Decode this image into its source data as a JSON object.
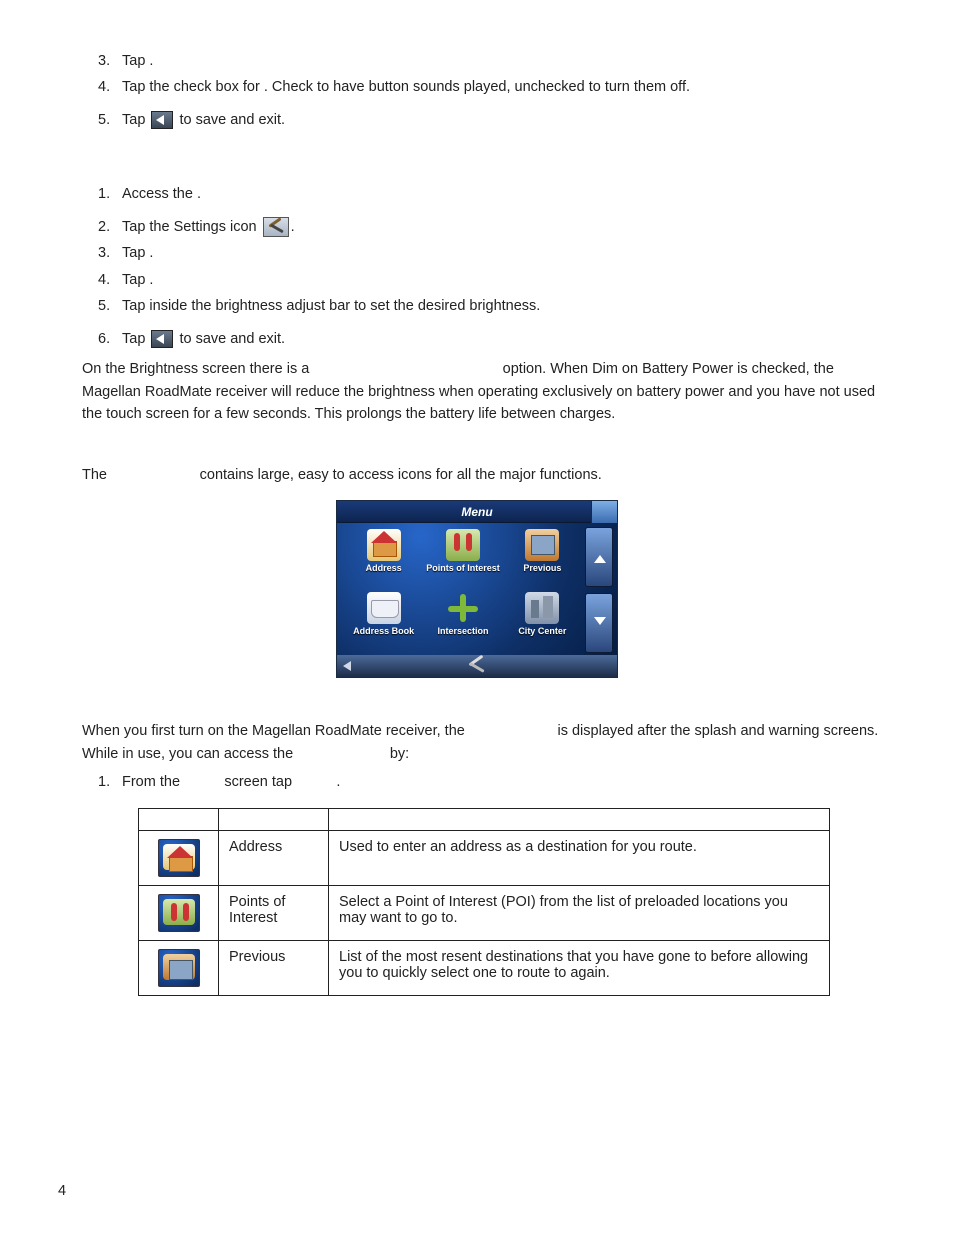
{
  "list1": {
    "3": "Tap ",
    "4a": "Tap the check box for ",
    "4b": ".  Check to have button sounds played, unchecked to turn them off.",
    "5a": "Tap ",
    "5b": " to save and exit."
  },
  "list2": {
    "1": "Access the ",
    "2": "Tap the Settings icon ",
    "3": "Tap ",
    "4": "Tap ",
    "5": "Tap inside the brightness adjust bar to set the desired brightness.",
    "6a": "Tap ",
    "6b": " to save and exit."
  },
  "brightness_para": "On the Brightness screen there is a                                                option. When Dim on Battery Power is checked, the Magellan RoadMate receiver will reduce the brightness when operating exclusively on battery power and you have not used the touch screen for a few seconds. This prolongs the battery life between charges.",
  "mainmenu_intro": "The                       contains large, easy to access icons for all the major functions.",
  "menu": {
    "title": "Menu",
    "items": [
      "Address",
      "Points of Interest",
      "Previous",
      "Address Book",
      "Intersection",
      "City Center"
    ]
  },
  "access_para": "When you first turn on the Magellan RoadMate receiver, the                       is displayed after the splash and warning screens. While in use, you can access the                        by:",
  "access_step": "From the           screen tap           .",
  "table": {
    "rows": [
      {
        "name": "Address",
        "desc": "Used to enter an address as a destination for you route.",
        "ico": "house"
      },
      {
        "name": "Points of Interest",
        "desc": "Select a Point of Interest (POI) from the list of preloaded locations you may want to go to.",
        "ico": "poi"
      },
      {
        "name": "Previous",
        "desc": "List of the most resent destinations that you have gone to before allowing you to quickly select one to route to again.",
        "ico": "prev"
      }
    ]
  },
  "page_number": "4"
}
